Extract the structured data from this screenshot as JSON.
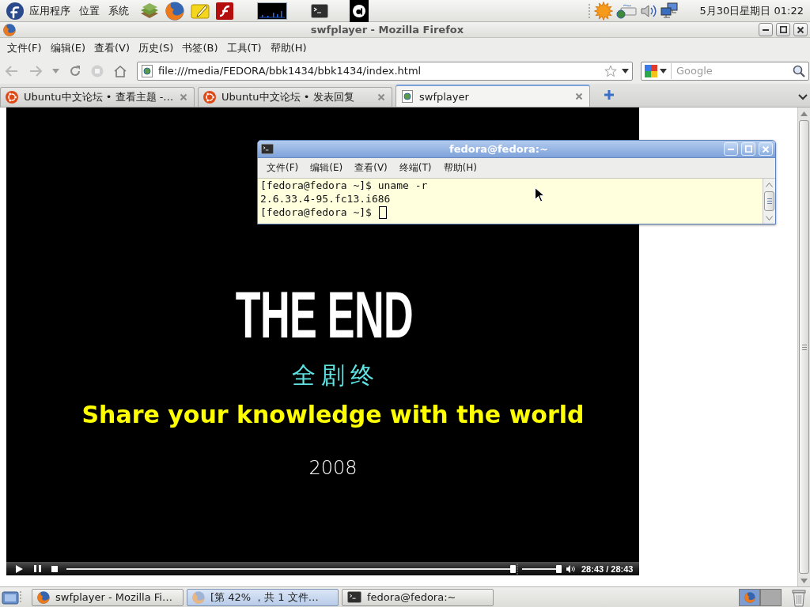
{
  "top_panel": {
    "menus": [
      "应用程序",
      "位置",
      "系统"
    ],
    "clock": "5月30日星期日 01:22"
  },
  "browser": {
    "title": "swfplayer - Mozilla Firefox",
    "focused": false,
    "menu_bar": [
      "文件(F)",
      "编辑(E)",
      "查看(V)",
      "历史(S)",
      "书签(B)",
      "工具(T)",
      "帮助(H)"
    ],
    "address": {
      "value": "file:///media/FEDORA/bbk1434/bbk1434/index.html"
    },
    "search": {
      "placeholder": "Google"
    },
    "tabs": [
      {
        "label": "Ubuntu中文论坛 • 查看主题 -…",
        "kind": "favicon",
        "selected": false
      },
      {
        "label": "Ubuntu中文论坛 • 发表回复",
        "kind": "favicon",
        "selected": false
      },
      {
        "label": "swfplayer",
        "kind": "page",
        "selected": true
      }
    ]
  },
  "player": {
    "headline": "THE END",
    "subtitle": "全剧终",
    "slogan": "Share your knowledge with the world",
    "year": "2008",
    "seek": {
      "level": 1
    },
    "volume": {
      "level": 1
    },
    "time": "28:43 / 28:43"
  },
  "terminal": {
    "title": "fedora@fedora:~",
    "focused": true,
    "menu_bar": [
      "文件(F)",
      "编辑(E)",
      "查看(V)",
      "终端(T)",
      "帮助(H)"
    ],
    "lines": [
      {
        "text": "[fedora@fedora ~]$ uname -r",
        "cursor": false
      },
      {
        "text": "2.6.33.4-95.fc13.i686",
        "cursor": false
      },
      {
        "text": "[fedora@fedora ~]$",
        "cursor": true
      }
    ]
  },
  "taskbar": {
    "tasks": [
      {
        "label": "swfplayer - Mozilla Fi…",
        "kind": "browser",
        "selected": false
      },
      {
        "label": "[第 42% ，共 1 文件…",
        "kind": "downloads",
        "selected": true
      },
      {
        "label": "fedora@fedora:~",
        "kind": "terminal",
        "selected": false
      }
    ],
    "workspaces": [
      {
        "selected": true
      },
      {
        "selected": false
      }
    ]
  }
}
